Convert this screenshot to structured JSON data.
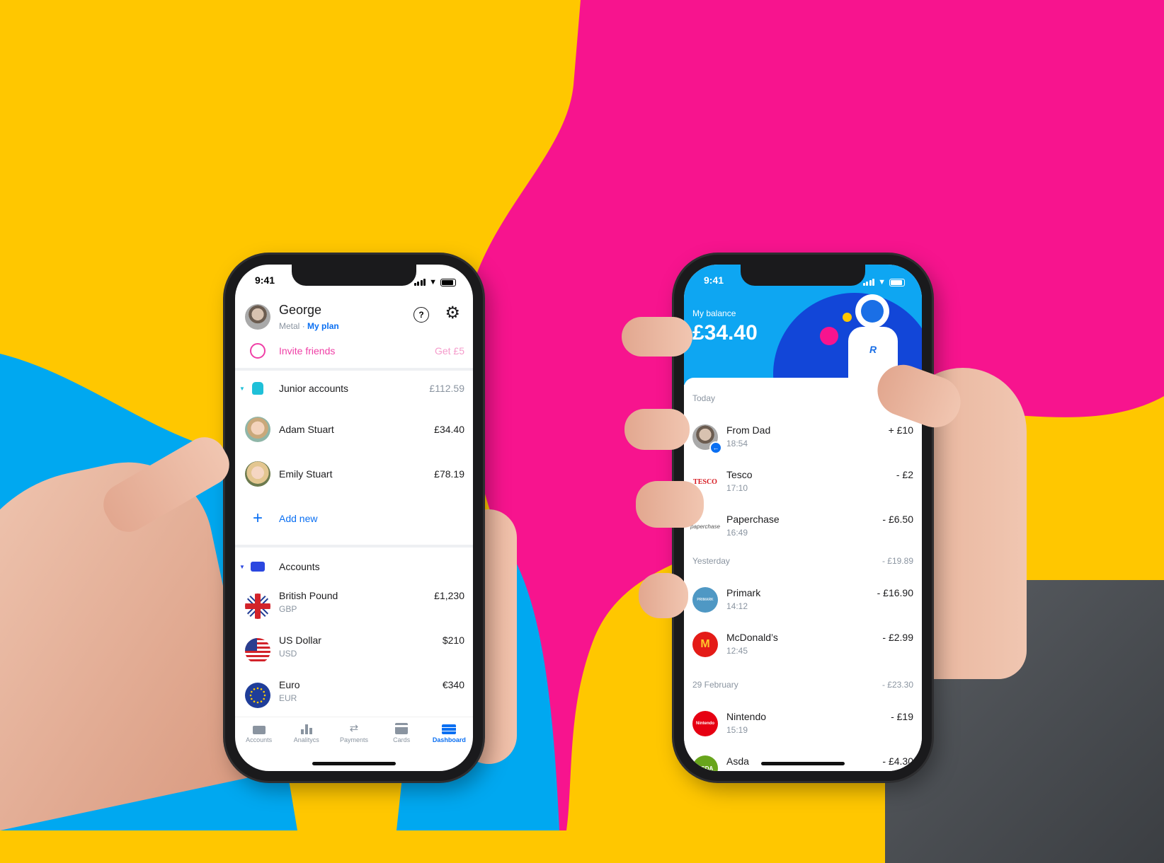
{
  "colors": {
    "bg_yellow": "#FFC700",
    "bg_pink": "#F7148E",
    "bg_blue": "#00A8F0",
    "accent_blue": "#0A6FF2",
    "accent_pink": "#EF3FA6",
    "junior_teal": "#1FC0D8",
    "header_blue": "#0EA6F2"
  },
  "left_phone": {
    "status_time": "9:41",
    "profile": {
      "name": "George",
      "plan_tier": "Metal",
      "separator": "·",
      "plan_link": "My plan",
      "help_icon": "help-bubble-icon",
      "settings_icon": "gear-icon"
    },
    "invite": {
      "label": "Invite friends",
      "reward": "Get £5",
      "icon": "smiley-hearts-icon"
    },
    "junior": {
      "label": "Junior accounts",
      "total": "£112.59",
      "members": [
        {
          "name": "Adam Stuart",
          "amount": "£34.40"
        },
        {
          "name": "Emily Stuart",
          "amount": "£78.19"
        }
      ],
      "add_label": "Add new"
    },
    "accounts": {
      "label": "Accounts",
      "items": [
        {
          "name": "British Pound",
          "code": "GBP",
          "amount": "£1,230",
          "flag": "uk-flag-icon"
        },
        {
          "name": "US Dollar",
          "code": "USD",
          "amount": "$210",
          "flag": "us-flag-icon"
        },
        {
          "name": "Euro",
          "code": "EUR",
          "amount": "€340",
          "flag": "eu-flag-icon"
        }
      ]
    },
    "tabs": [
      {
        "label": "Accounts",
        "icon": "wallet-icon",
        "active": false
      },
      {
        "label": "Analitycs",
        "icon": "bar-chart-icon",
        "active": false
      },
      {
        "label": "Payments",
        "icon": "transfer-arrows-icon",
        "active": false
      },
      {
        "label": "Cards",
        "icon": "card-icon",
        "active": false
      },
      {
        "label": "Dashboard",
        "icon": "dashboard-icon",
        "active": true
      }
    ]
  },
  "right_phone": {
    "status_time": "9:41",
    "balance_label": "My balance",
    "balance": "£34.40",
    "groups": [
      {
        "day": "Today",
        "total": "",
        "items": [
          {
            "name": "From Dad",
            "time": "18:54",
            "amount": "+ £10",
            "logo": "avatar"
          },
          {
            "name": "Tesco",
            "time": "17:10",
            "amount": "- £2",
            "logo": "TESCO"
          },
          {
            "name": "Paperchase",
            "time": "16:49",
            "amount": "- £6.50",
            "logo": "paperchase"
          }
        ]
      },
      {
        "day": "Yesterday",
        "total": "- £19.89",
        "items": [
          {
            "name": "Primark",
            "time": "14:12",
            "amount": "- £16.90",
            "logo": "PRIMARK"
          },
          {
            "name": "McDonald’s",
            "time": "12:45",
            "amount": "- £2.99",
            "logo": "M"
          }
        ]
      },
      {
        "day": "29 February",
        "total": "- £23.30",
        "items": [
          {
            "name": "Nintendo",
            "time": "15:19",
            "amount": "- £19",
            "logo": "Nintendo"
          },
          {
            "name": "Asda",
            "time": "",
            "amount": "- £4.30",
            "logo": "ASDA"
          }
        ]
      }
    ]
  }
}
